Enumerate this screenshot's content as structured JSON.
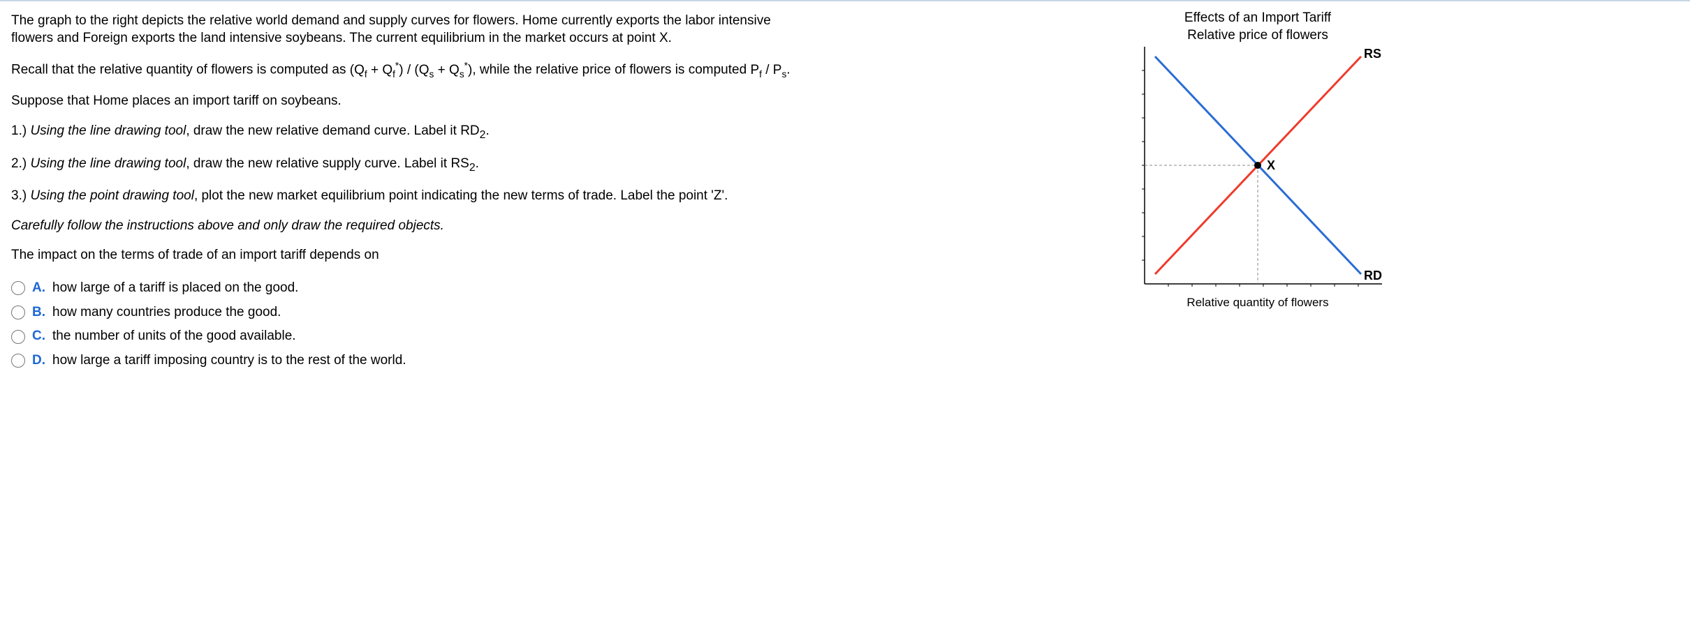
{
  "text": {
    "intro1": "The graph to the right depicts the relative world demand and supply curves for flowers. Home currently exports the labor intensive flowers and Foreign exports the land intensive soybeans. The current equilibrium in the market occurs at point X.",
    "recall_prefix": "Recall that the relative quantity of flowers is computed as ",
    "recall_mid": ", while the relative price of flowers is computed ",
    "recall_end": ".",
    "suppose": "Suppose that Home places an import tariff on soybeans.",
    "step1_pre": "1.) ",
    "step1_tool": "Using the line drawing tool",
    "step1_rest": ", draw the new relative demand curve. Label it RD",
    "step1_sub": "2",
    "step1_end": ".",
    "step2_pre": "2.) ",
    "step2_tool": "Using the line drawing tool",
    "step2_rest": ", draw the new relative supply curve. Label it RS",
    "step2_sub": "2",
    "step2_end": ".",
    "step3_pre": "3.) ",
    "step3_tool": "Using the point drawing tool",
    "step3_rest": ", plot the new market equilibrium point indicating the new terms of trade. Label the point 'Z'.",
    "careful": "Carefully follow the instructions above and only draw the required objects.",
    "impact": "The impact on the terms of trade of an import tariff depends on"
  },
  "choices": [
    {
      "letter": "A.",
      "text": "how large of a tariff is placed on the good."
    },
    {
      "letter": "B.",
      "text": "how many countries produce the good."
    },
    {
      "letter": "C.",
      "text": "the number of units of the good available."
    },
    {
      "letter": "D.",
      "text": "how large a tariff imposing country is to the rest of the world."
    }
  ],
  "chart": {
    "title_line1": "Effects of an Import Tariff",
    "title_line2": "Relative price of flowers",
    "x_axis_label": "Relative quantity of flowers",
    "rs_label": "RS",
    "rd_label": "RD",
    "x_label": "X"
  },
  "chart_data": {
    "type": "line",
    "title": "Effects of an Import Tariff",
    "xlabel": "Relative quantity of flowers",
    "ylabel": "Relative price of flowers",
    "xlim": [
      0,
      10
    ],
    "ylim": [
      0,
      10
    ],
    "series": [
      {
        "name": "RS",
        "color": "#ef3b2c",
        "x": [
          0.5,
          9.5
        ],
        "y": [
          0.5,
          9.5
        ]
      },
      {
        "name": "RD",
        "color": "#2b6cd4",
        "x": [
          0.5,
          9.5
        ],
        "y": [
          9.5,
          0.5
        ]
      }
    ],
    "points": [
      {
        "name": "X",
        "x": 5,
        "y": 5
      }
    ]
  }
}
